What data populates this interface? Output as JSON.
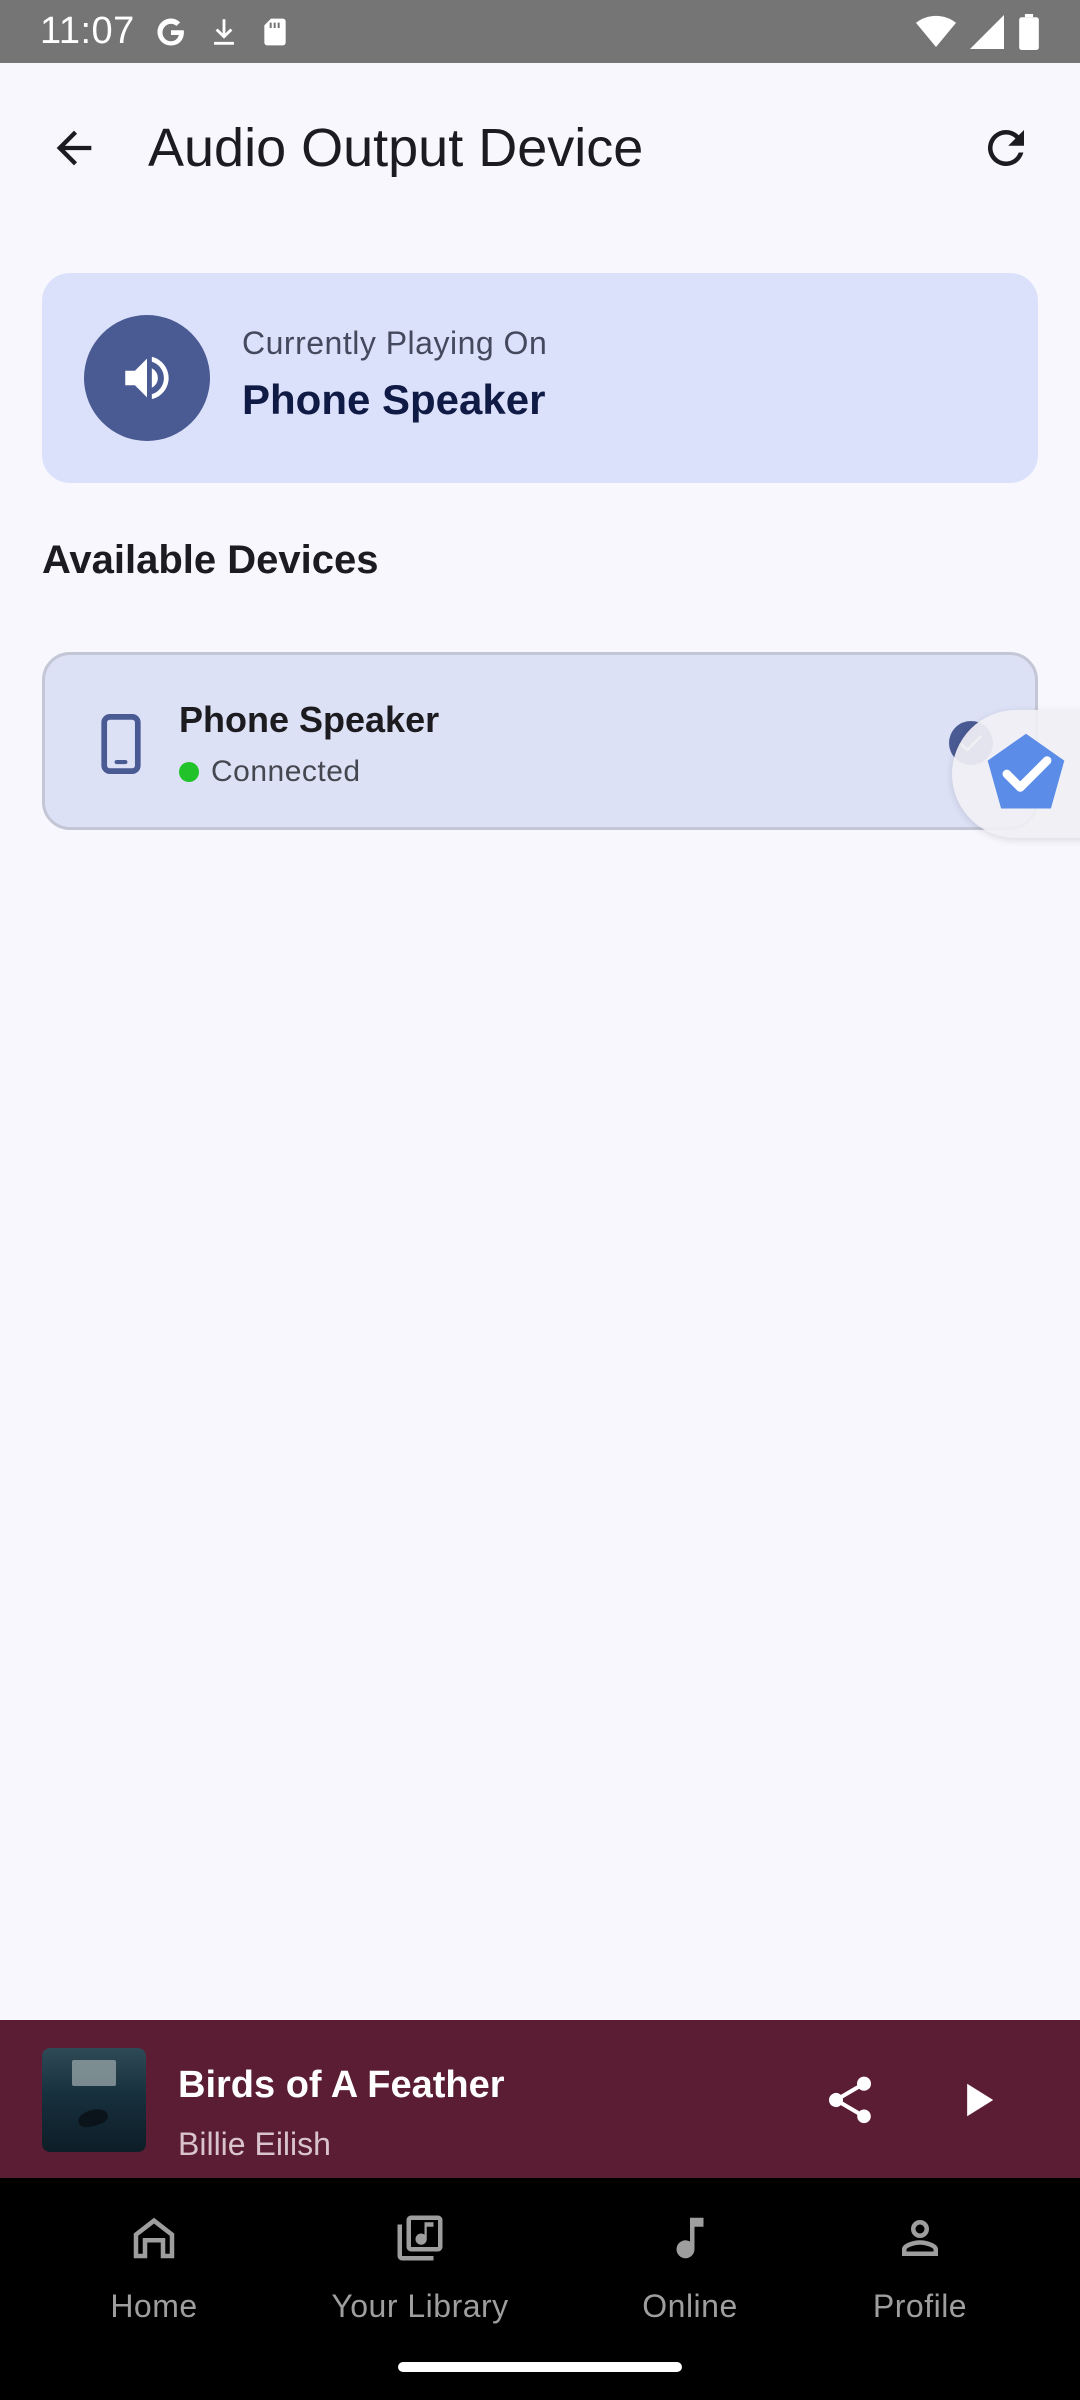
{
  "status_bar": {
    "time": "11:07",
    "left_icons": [
      "google-icon",
      "download-icon",
      "sd-card-icon"
    ],
    "right_icons": [
      "wifi-icon",
      "signal-icon",
      "battery-icon"
    ]
  },
  "app_bar": {
    "title": "Audio Output Device",
    "back_icon": "arrow-back-icon",
    "refresh_icon": "refresh-icon"
  },
  "current": {
    "label": "Currently Playing On",
    "device": "Phone Speaker",
    "icon": "volume-up-icon"
  },
  "section": {
    "title": "Available Devices"
  },
  "devices": [
    {
      "name": "Phone Speaker",
      "status": "Connected",
      "icon": "phone-icon",
      "selected": true,
      "status_color": "#22c32a"
    }
  ],
  "mini_player": {
    "title": "Birds of A Feather",
    "artist": "Billie Eilish",
    "background": "#5a1d33"
  },
  "bottom_nav": {
    "items": [
      {
        "label": "Home",
        "icon": "home-icon"
      },
      {
        "label": "Your Library",
        "icon": "library-icon"
      },
      {
        "label": "Online",
        "icon": "music-note-icon"
      },
      {
        "label": "Profile",
        "icon": "person-icon"
      }
    ]
  },
  "colors": {
    "accent": "#4a5a93",
    "card_bg": "#dce1fb",
    "background": "#f7f7fd"
  }
}
